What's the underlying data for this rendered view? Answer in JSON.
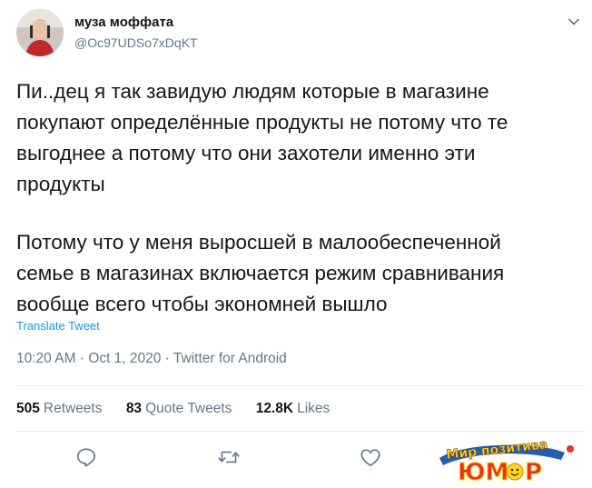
{
  "user": {
    "name": "муза моффата",
    "handle": "@Oc97UDSo7xDqKT"
  },
  "tweet": {
    "paragraph1": "Пи..дец я так завидую людям которые в магазине\nпокупают определённые продукты не потому что те\nвыгоднее а потому что они захотели именно эти\nпродукты",
    "paragraph2": "Потому что у меня выросшей в малообеспеченной\nсемье в магазинах включается режим сравнивания\nвообще всего чтобы экономней вышло",
    "translate_label": "Translate Tweet",
    "meta": "10:20 AM · Oct 1, 2020 · Twitter for Android"
  },
  "stats": {
    "retweets_count": "505",
    "retweets_label": "Retweets",
    "quotes_count": "83",
    "quotes_label": "Quote Tweets",
    "likes_count": "12.8K",
    "likes_label": "Likes"
  },
  "actions": {
    "icons": [
      "reply-icon",
      "retweet-icon",
      "like-icon"
    ]
  },
  "watermark": {
    "line1": "Мир позитива",
    "line2": "ЮМОР"
  },
  "colors": {
    "text": "#14171a",
    "secondary": "#657786",
    "link": "#1b95e0",
    "divider": "#e6ecf0",
    "icon": "#657786"
  }
}
